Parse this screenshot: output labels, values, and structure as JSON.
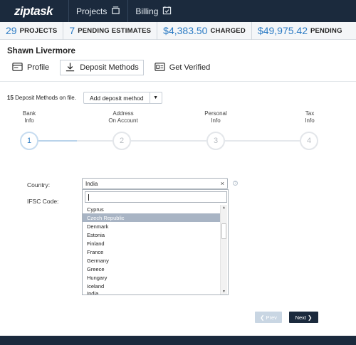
{
  "topbar": {
    "logo": "ziptask",
    "nav": [
      {
        "label": "Projects",
        "icon": "cards-icon"
      },
      {
        "label": "Billing",
        "icon": "calendar-check-icon"
      }
    ]
  },
  "stats": [
    {
      "value": "29",
      "label": "PROJECTS"
    },
    {
      "value": "7",
      "label": "PENDING ESTIMATES"
    },
    {
      "value": "$4,383.50",
      "label": "CHARGED"
    },
    {
      "value": "$49,975.42",
      "label": "PENDING"
    }
  ],
  "user": {
    "name": "Shawn Livermore"
  },
  "tabs": [
    {
      "label": "Profile",
      "icon": "profile-card-icon",
      "active": false
    },
    {
      "label": "Deposit Methods",
      "icon": "download-icon",
      "active": true
    },
    {
      "label": "Get Verified",
      "icon": "id-card-icon",
      "active": false
    }
  ],
  "deposit": {
    "count_text": "15",
    "count_suffix": "Deposit Methods on file.",
    "add_label": "Add deposit method"
  },
  "steps": [
    {
      "line1": "Bank",
      "line2": "Info",
      "number": "1"
    },
    {
      "line1": "Address",
      "line2": "On Account",
      "number": "2"
    },
    {
      "line1": "Personal",
      "line2": "Info",
      "number": "3"
    },
    {
      "line1": "Tax",
      "line2": "Info",
      "number": "4"
    }
  ],
  "form": {
    "country_label": "Country:",
    "ifsc_label": "IFSC Code:",
    "country_value": "India",
    "clear_symbol": "×",
    "help_symbol": "?"
  },
  "dropdown_options": [
    "Cyprus",
    "Czech Republic",
    "Denmark",
    "Estonia",
    "Finland",
    "France",
    "Germany",
    "Greece",
    "Hungary",
    "Iceland",
    "India"
  ],
  "dropdown_highlight": "Czech Republic",
  "nav_buttons": {
    "prev": "❮ Prev",
    "next": "Next ❯"
  },
  "colors": {
    "navy": "#1b2a3d",
    "accent": "#2b7bc4",
    "highlight": "#a8b4c4"
  }
}
